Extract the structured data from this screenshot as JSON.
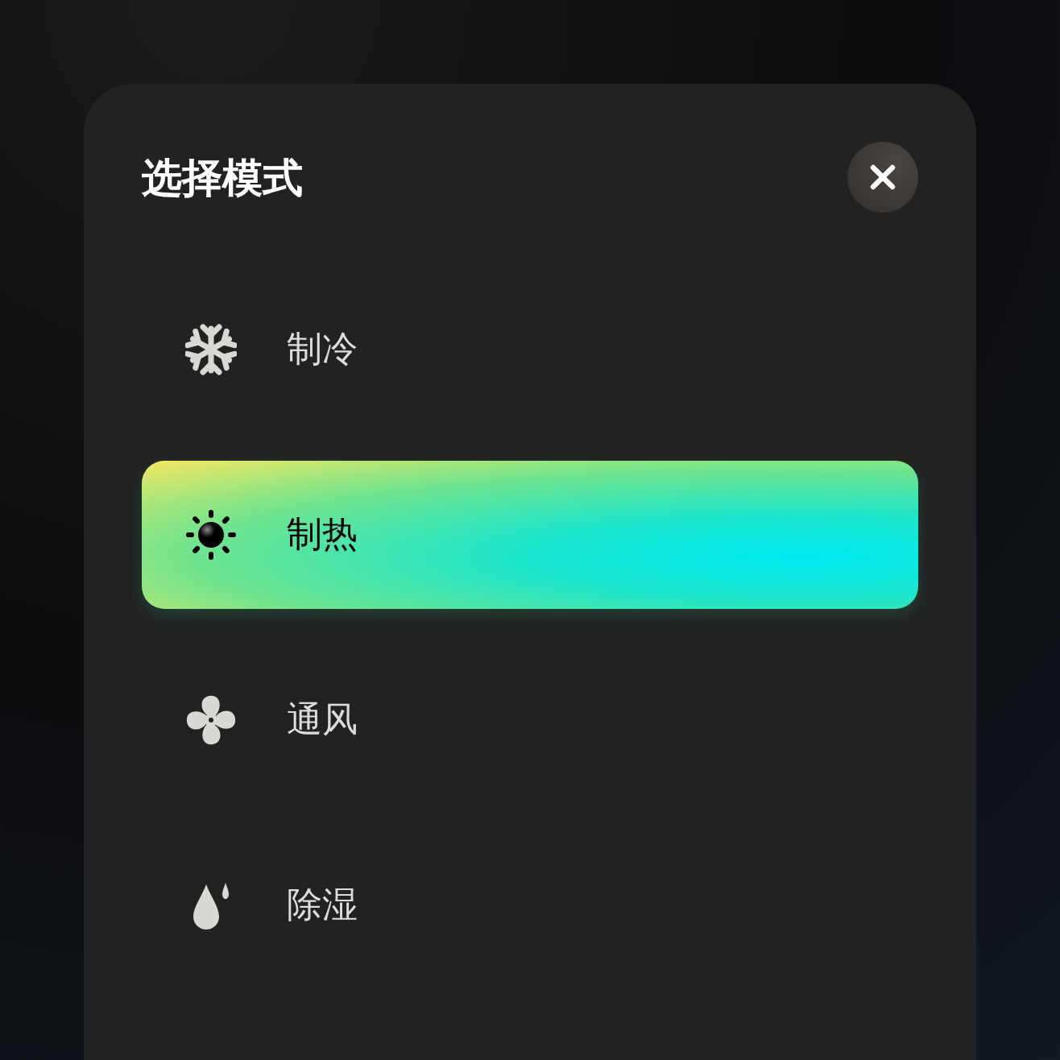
{
  "dialog": {
    "title": "选择模式"
  },
  "modes": [
    {
      "label": "制冷",
      "kind": "snow",
      "selected": false
    },
    {
      "label": "制热",
      "kind": "sun",
      "selected": true
    },
    {
      "label": "通风",
      "kind": "fan",
      "selected": false
    },
    {
      "label": "除湿",
      "kind": "drop",
      "selected": false
    }
  ]
}
